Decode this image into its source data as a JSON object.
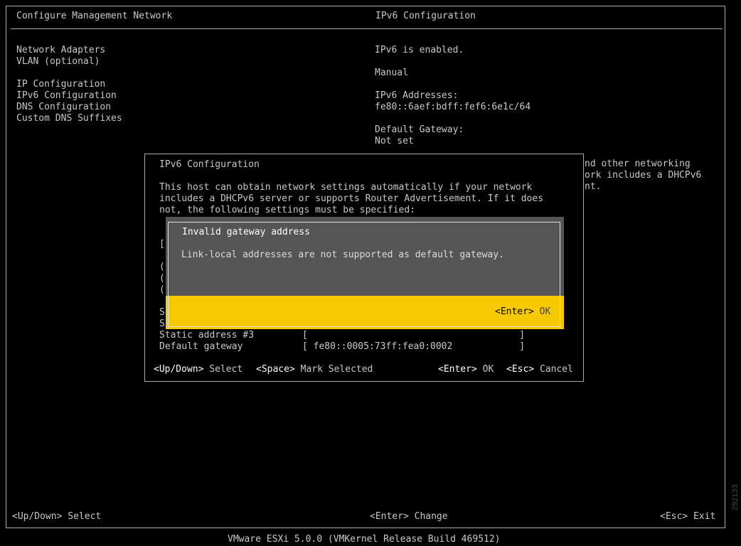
{
  "header": {
    "left_title": "Configure Management Network",
    "right_title": "IPv6 Configuration"
  },
  "menu": {
    "items": [
      "Network Adapters",
      "VLAN (optional)",
      "",
      "IP Configuration",
      "IPv6 Configuration",
      "DNS Configuration",
      "Custom DNS Suffixes"
    ]
  },
  "right_panel": {
    "lines": [
      "IPv6 is enabled.",
      "",
      "Manual",
      "",
      "IPv6 Addresses:",
      "fe80::6aef:bdff:fef6:6e1c/64",
      "",
      "Default Gateway:",
      "Not set"
    ],
    "overflow_lines": [
      "nd other networking",
      "ork includes a DHCPv6",
      "nt."
    ]
  },
  "ipv6_dialog": {
    "title": "IPv6 Configuration",
    "description": [
      "This host can obtain network settings automatically if your network",
      "includes a DHCPv6 server or supports Router Advertisement. If it does",
      "not, the following settings must be specified:"
    ],
    "partial_row_chars": [
      "[",
      "(",
      "(",
      "(",
      "S",
      "S"
    ],
    "static_address_3_label": "Static address #3",
    "static_address_3_value": "[                                      ]",
    "default_gateway_label": "Default gateway",
    "default_gateway_value": "[ fe80::0005:73ff:fea0:0002            ]",
    "footer_select_key": "<Up/Down>",
    "footer_select": "Select",
    "footer_mark_key": "<Space>",
    "footer_mark": "Mark Selected",
    "footer_ok_key": "<Enter>",
    "footer_ok": "OK",
    "footer_cancel_key": "<Esc>",
    "footer_cancel": "Cancel"
  },
  "error_popup": {
    "title": "Invalid gateway address",
    "message": "Link-local addresses are not supported as default gateway.",
    "ok_key": "<Enter>",
    "ok_label": "OK"
  },
  "footer": {
    "select_key": "<Up/Down>",
    "select_label": "Select",
    "change_key": "<Enter>",
    "change_label": "Change",
    "exit_key": "<Esc>",
    "exit_label": "Exit",
    "version": "VMware ESXi 5.0.0 (VMKernel Release Build 469512)"
  },
  "watermark": "292133"
}
